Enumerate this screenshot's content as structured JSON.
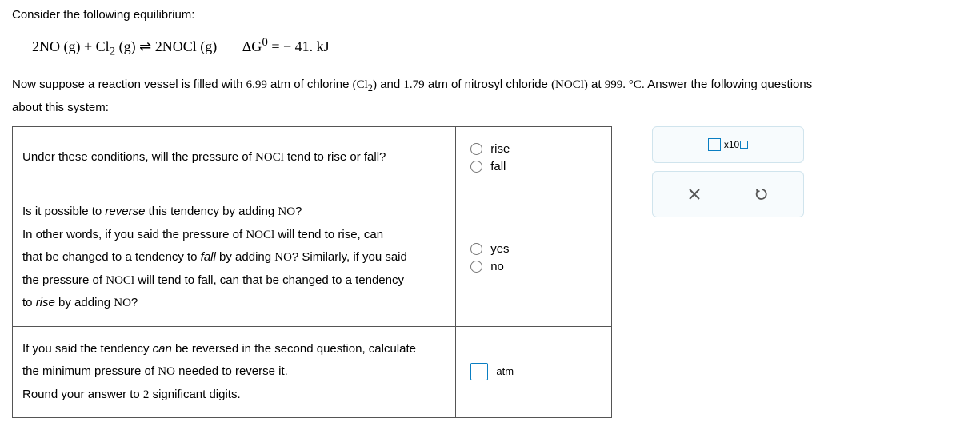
{
  "intro": "Consider the following equilibrium:",
  "equation_html": "2NO (g) + Cl₂ (g) ⇌ 2NOCl (g)      ΔG⁰ = − 41. kJ",
  "equation": {
    "left": "2NO (g) + Cl",
    "sub1": "2",
    "mid": " (g) ⇌ 2NOCl (g)",
    "dg": "ΔG",
    "sup0": "0",
    "eq": " = − 41. kJ"
  },
  "context": {
    "p1a": "Now suppose a reaction vessel is filled with ",
    "v1": "6.99",
    "p1b": " atm of chlorine ",
    "cl2a": "(Cl",
    "cl2sub": "2",
    "cl2b": ")",
    "p1c": " and ",
    "v2": "1.79",
    "p1d": " atm of nitrosyl chloride ",
    "nocl": "(NOCl)",
    "p1e": " at ",
    "temp": "999. °C",
    "p1f": ". Answer the following questions",
    "p2": "about this system:"
  },
  "q1": {
    "a": "Under these conditions, will the pressure of ",
    "n": "NOCl",
    "b": " tend to rise or fall?",
    "opt_rise": "rise",
    "opt_fall": "fall"
  },
  "q2": {
    "l1a": "Is it possible to ",
    "l1b": "reverse",
    "l1c": " this tendency by adding ",
    "l1d": "NO",
    "l1e": "?",
    "l2a": "In other words, if you said the pressure of ",
    "l2b": "NOCl",
    "l2c": " will tend to rise, can ",
    "l3a": "that be changed to a tendency to ",
    "l3b": "fall",
    "l3c": " by adding ",
    "l3d": "NO",
    "l3e": "? Similarly, if you said ",
    "l4a": "the pressure of ",
    "l4b": "NOCl",
    "l4c": " will tend to fall, can that be changed to a tendency ",
    "l5a": "to ",
    "l5b": "rise",
    "l5c": " by adding ",
    "l5d": "NO",
    "l5e": "?",
    "opt_yes": "yes",
    "opt_no": "no"
  },
  "q3": {
    "l1a": "If you said the tendency ",
    "l1b": "can",
    "l1c": " be reversed in the second question, calculate ",
    "l2a": "the minimum pressure of ",
    "l2b": "NO",
    "l2c": " needed to reverse it.",
    "l3a": "Round your answer to ",
    "l3b": "2",
    "l3c": " significant digits.",
    "unit": "atm"
  },
  "sci": {
    "x10": "x10"
  }
}
